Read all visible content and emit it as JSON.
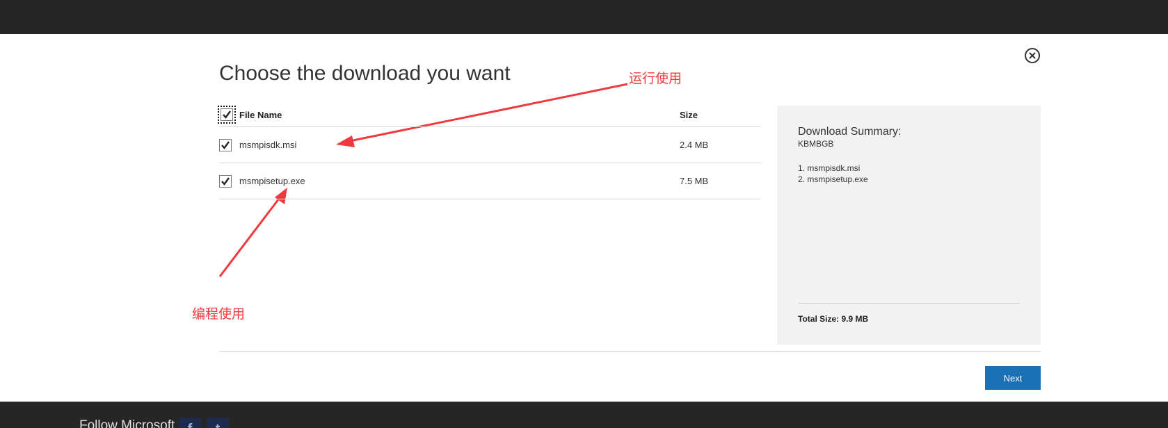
{
  "dialog": {
    "title": "Choose the download you want",
    "close_icon": "close-circle-icon"
  },
  "table": {
    "headers": {
      "file_name": "File Name",
      "size": "Size"
    },
    "rows": [
      {
        "name": "msmpisdk.msi",
        "size": "2.4 MB",
        "checked": true
      },
      {
        "name": "msmpisetup.exe",
        "size": "7.5 MB",
        "checked": true
      }
    ]
  },
  "annotations": {
    "runtime": "运行使用",
    "programming": "编程使用",
    "arrow_color": "#f0393e"
  },
  "summary": {
    "title": "Download Summary:",
    "subtitle": "KBMBGB",
    "items": [
      "1. msmpisdk.msi",
      "2. msmpisetup.exe"
    ],
    "total": "Total Size: 9.9 MB"
  },
  "actions": {
    "next_label": "Next"
  },
  "footer": {
    "follow_text": "Follow Microsoft",
    "facebook_glyph": "f",
    "twitter_glyph": "t"
  },
  "colors": {
    "primary_button": "#1b6fb5",
    "top_bar": "#262626",
    "summary_bg": "#f2f2f2"
  }
}
